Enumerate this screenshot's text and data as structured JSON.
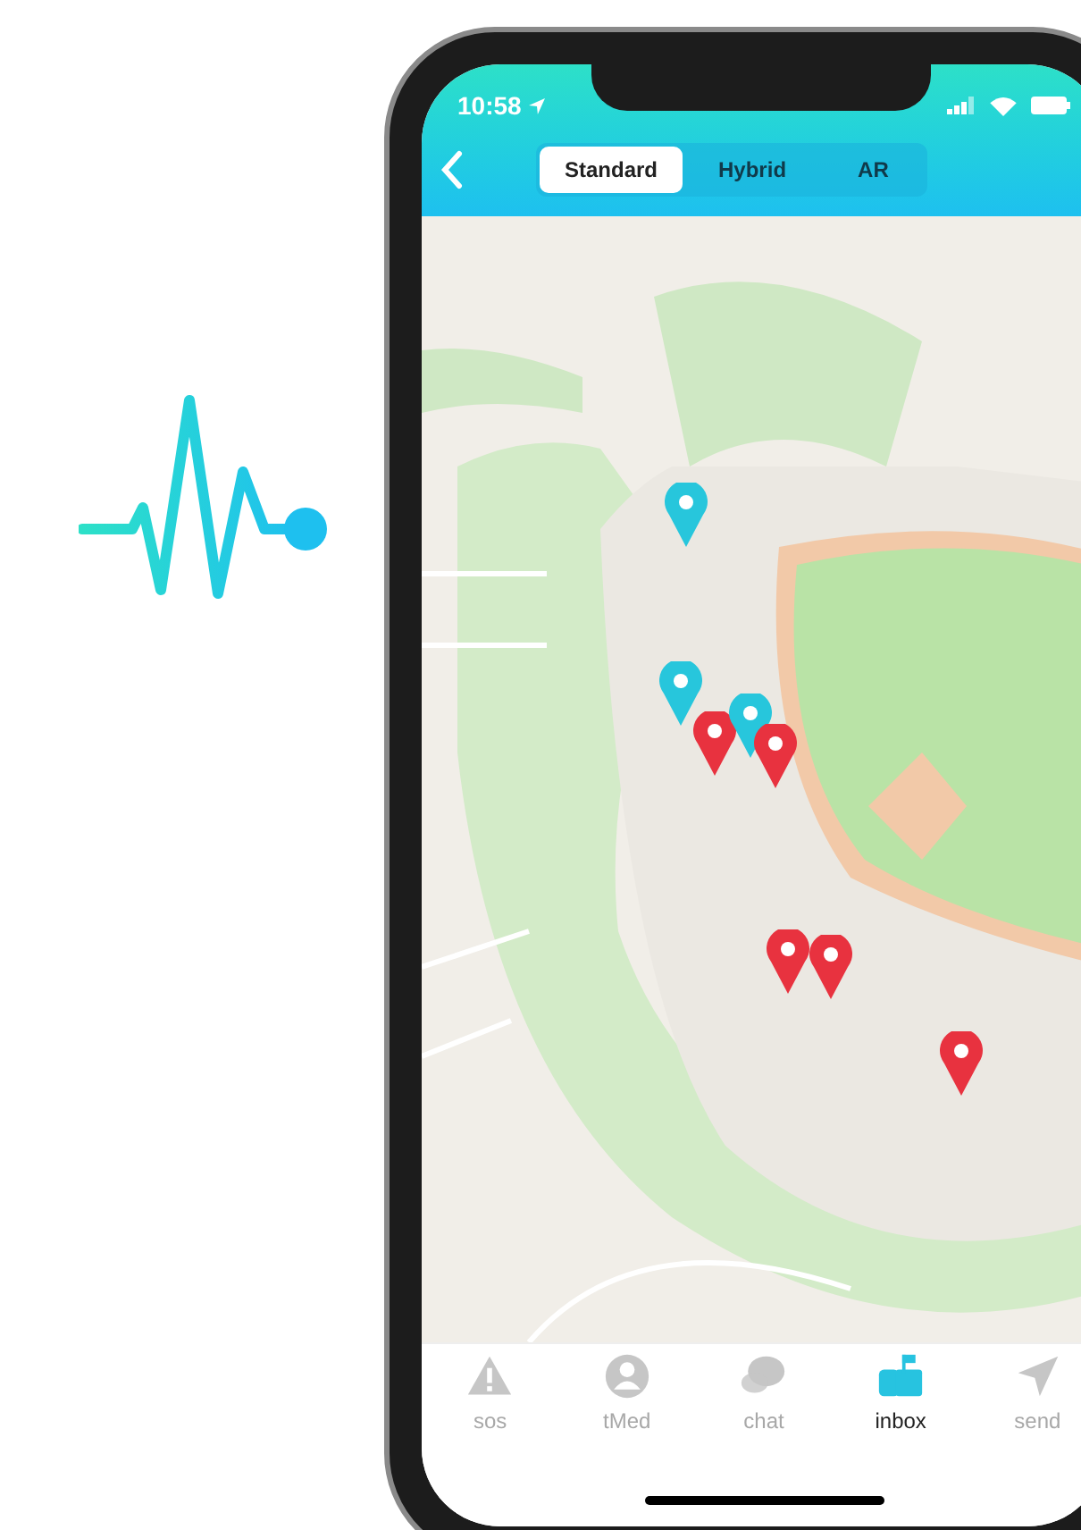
{
  "status_bar": {
    "time": "10:58"
  },
  "map_modes": [
    {
      "label": "Standard",
      "selected": true
    },
    {
      "label": "Hybrid",
      "selected": false
    },
    {
      "label": "AR",
      "selected": false
    }
  ],
  "pins": [
    {
      "color": "#27c6dc"
    },
    {
      "color": "#27c6dc"
    },
    {
      "color": "#e8323f"
    },
    {
      "color": "#27c6dc"
    },
    {
      "color": "#e8323f"
    },
    {
      "color": "#e8323f"
    },
    {
      "color": "#e8323f"
    },
    {
      "color": "#e8323f"
    }
  ],
  "tab_bar": [
    {
      "label": "sos",
      "selected": false
    },
    {
      "label": "tMed",
      "selected": false
    },
    {
      "label": "chat",
      "selected": false
    },
    {
      "label": "inbox",
      "selected": true
    },
    {
      "label": "send",
      "selected": false
    }
  ]
}
